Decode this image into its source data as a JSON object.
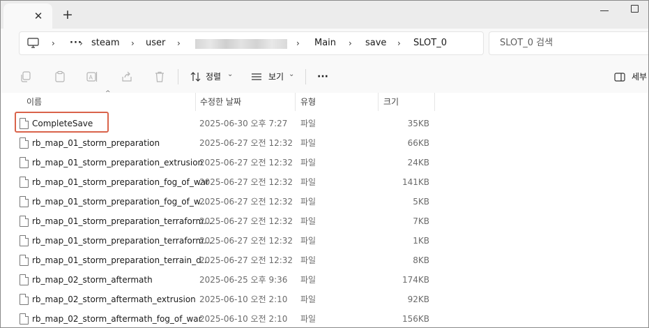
{
  "tabs": {
    "close_glyph": "✕",
    "new_tab_glyph": "+"
  },
  "breadcrumb": {
    "computer_icon": "monitor-icon",
    "overflow": "···",
    "items": [
      "steam",
      "user",
      "Main",
      "save",
      "SLOT_0"
    ],
    "chevron": "›"
  },
  "search": {
    "placeholder": "SLOT_0 검색"
  },
  "toolbar": {
    "sort_label": "정렬",
    "view_label": "보기",
    "details_label": "세부",
    "more_label": "···",
    "dropdown_glyph": "⌄"
  },
  "columns": {
    "name": "이름",
    "date": "수정한 날짜",
    "type": "유형",
    "size": "크기"
  },
  "files": [
    {
      "name": "CompleteSave",
      "date": "2025-06-30 오후 7:27",
      "type": "파일",
      "size": "35KB"
    },
    {
      "name": "rb_map_01_storm_preparation",
      "date": "2025-06-27 오전 12:32",
      "type": "파일",
      "size": "66KB"
    },
    {
      "name": "rb_map_01_storm_preparation_extrusion",
      "date": "2025-06-27 오전 12:32",
      "type": "파일",
      "size": "24KB"
    },
    {
      "name": "rb_map_01_storm_preparation_fog_of_war",
      "date": "2025-06-27 오전 12:32",
      "type": "파일",
      "size": "141KB"
    },
    {
      "name": "rb_map_01_storm_preparation_fog_of_w...",
      "date": "2025-06-27 오전 12:32",
      "type": "파일",
      "size": "5KB"
    },
    {
      "name": "rb_map_01_storm_preparation_terraform...",
      "date": "2025-06-27 오전 12:32",
      "type": "파일",
      "size": "7KB"
    },
    {
      "name": "rb_map_01_storm_preparation_terraform...",
      "date": "2025-06-27 오전 12:32",
      "type": "파일",
      "size": "1KB"
    },
    {
      "name": "rb_map_01_storm_preparation_terrain_d...",
      "date": "2025-06-27 오전 12:32",
      "type": "파일",
      "size": "8KB"
    },
    {
      "name": "rb_map_02_storm_aftermath",
      "date": "2025-06-25 오후 9:36",
      "type": "파일",
      "size": "174KB"
    },
    {
      "name": "rb_map_02_storm_aftermath_extrusion",
      "date": "2025-06-10 오전 2:10",
      "type": "파일",
      "size": "92KB"
    },
    {
      "name": "rb_map_02_storm_aftermath_fog_of_war",
      "date": "2025-06-10 오전 2:10",
      "type": "파일",
      "size": "156KB"
    }
  ],
  "colors": {
    "highlight": "#d9634a",
    "chrome": "#f9f9f9",
    "titlebar": "#ececec"
  }
}
